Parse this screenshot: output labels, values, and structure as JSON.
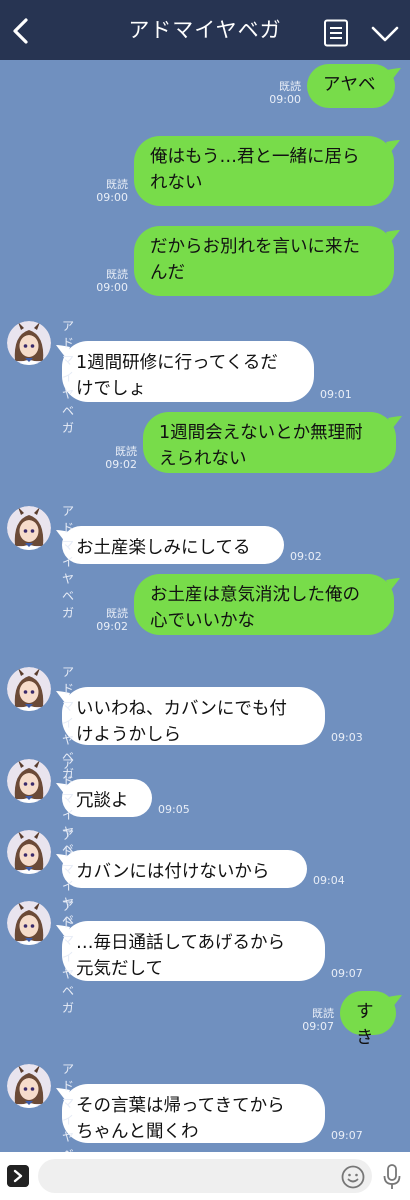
{
  "header": {
    "title": "アドマイヤベガ"
  },
  "sender_name": "アドマイヤベガ",
  "read_label": "既読",
  "messages": [
    {
      "side": "me",
      "text": "アヤベ",
      "time": "09:00",
      "read": true
    },
    {
      "side": "me",
      "text": "俺はもう…君と一緒に居ら\nれない",
      "time": "09:00",
      "read": true
    },
    {
      "side": "me",
      "text": "だからお別れを言いに来た\nんだ",
      "time": "09:00",
      "read": true
    },
    {
      "side": "them",
      "text": "1週間研修に行ってくるだ\nけでしょ",
      "time": "09:01"
    },
    {
      "side": "me",
      "text": "1週間会えないとか無理耐\nえられない",
      "time": "09:02",
      "read": true
    },
    {
      "side": "them",
      "text": "お土産楽しみにしてる",
      "time": "09:02"
    },
    {
      "side": "me",
      "text": "お土産は意気消沈した俺の\n心でいいかな",
      "time": "09:02",
      "read": true
    },
    {
      "side": "them",
      "text": "いいわね、カバンにでも付\nけようかしら",
      "time": "09:03"
    },
    {
      "side": "them",
      "text": "冗談よ",
      "time": "09:05"
    },
    {
      "side": "them",
      "text": "カバンには付けないから",
      "time": "09:04"
    },
    {
      "side": "them",
      "text": "…毎日通話してあげるから\n元気だして",
      "time": "09:07"
    },
    {
      "side": "me",
      "text": "すき",
      "time": "09:07",
      "read": true
    },
    {
      "side": "them",
      "text": "その言葉は帰ってきてから\nちゃんと聞くわ",
      "time": "09:07"
    }
  ],
  "input": {
    "placeholder": "",
    "value": ""
  },
  "colors": {
    "header": "#273452",
    "chat_bg": "#7090bf",
    "my_bubble": "#78dc4a",
    "their_bubble": "#ffffff"
  },
  "icons": [
    "back-icon",
    "menu-list-icon",
    "chevron-down-icon",
    "expand-icon",
    "emoji-icon",
    "microphone-icon",
    "avatar"
  ]
}
